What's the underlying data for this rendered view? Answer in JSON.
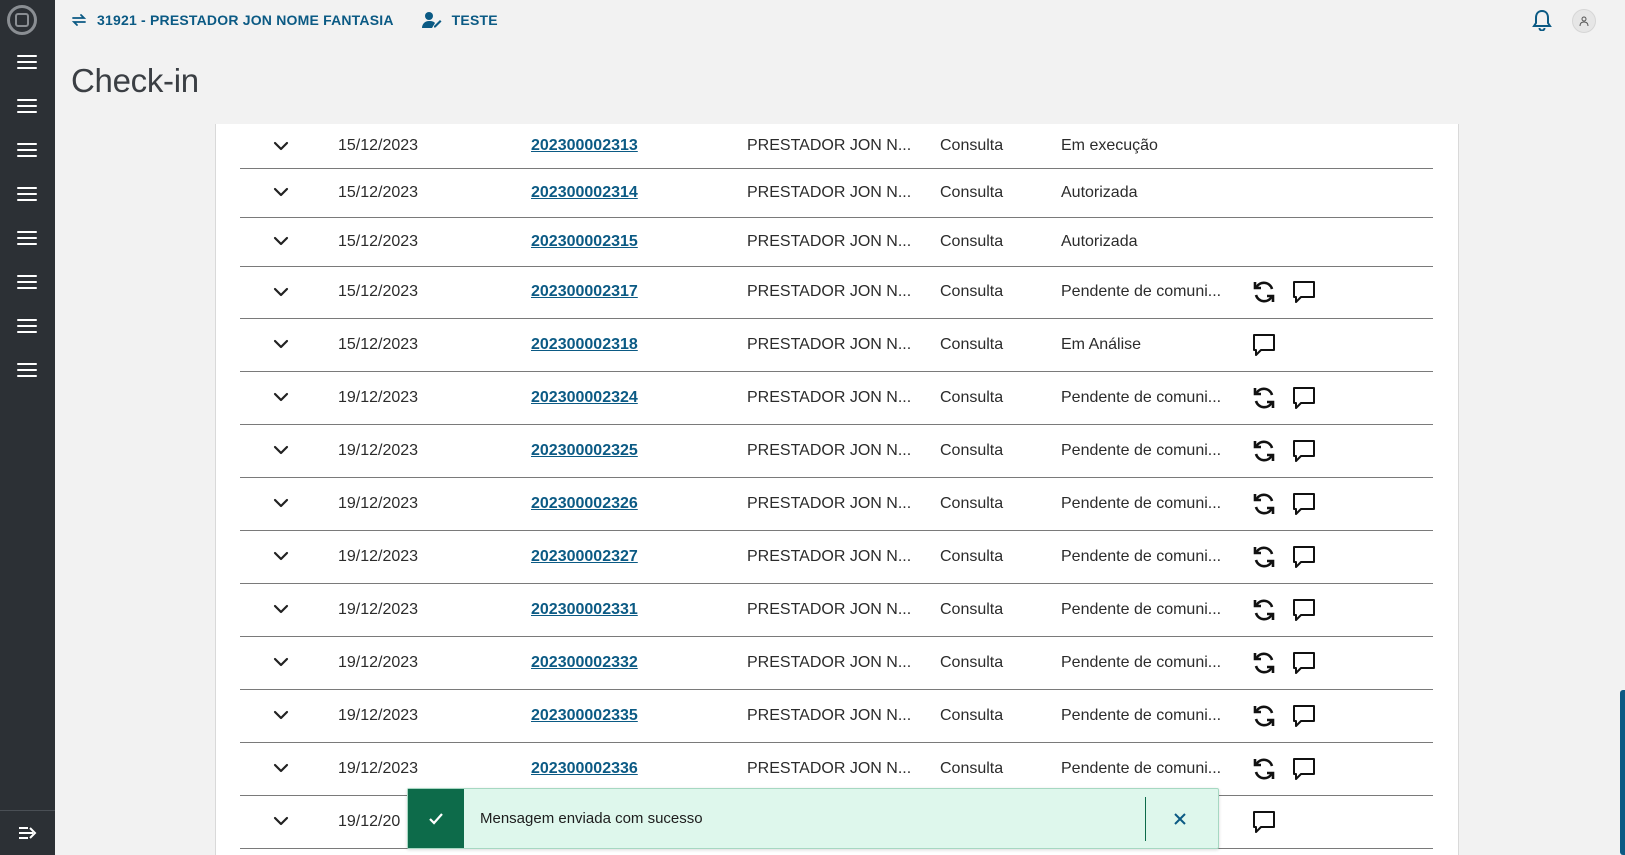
{
  "header": {
    "provider": "31921 - PRESTADOR JON NOME FANTASIA",
    "user": "TESTE"
  },
  "page": {
    "title": "Check-in"
  },
  "table": {
    "rows": [
      {
        "date": "15/12/2023",
        "number": "202300002313",
        "provider": "PRESTADOR JON N...",
        "type": "Consulta",
        "status": "Em execução",
        "actions": []
      },
      {
        "date": "15/12/2023",
        "number": "202300002314",
        "provider": "PRESTADOR JON N...",
        "type": "Consulta",
        "status": "Autorizada",
        "actions": []
      },
      {
        "date": "15/12/2023",
        "number": "202300002315",
        "provider": "PRESTADOR JON N...",
        "type": "Consulta",
        "status": "Autorizada",
        "actions": []
      },
      {
        "date": "15/12/2023",
        "number": "202300002317",
        "provider": "PRESTADOR JON N...",
        "type": "Consulta",
        "status": "Pendente de comuni...",
        "actions": [
          "refresh-icon",
          "chat-icon"
        ]
      },
      {
        "date": "15/12/2023",
        "number": "202300002318",
        "provider": "PRESTADOR JON N...",
        "type": "Consulta",
        "status": "Em Análise",
        "actions": [
          "chat-icon"
        ]
      },
      {
        "date": "19/12/2023",
        "number": "202300002324",
        "provider": "PRESTADOR JON N...",
        "type": "Consulta",
        "status": "Pendente de comuni...",
        "actions": [
          "refresh-icon",
          "chat-icon"
        ]
      },
      {
        "date": "19/12/2023",
        "number": "202300002325",
        "provider": "PRESTADOR JON N...",
        "type": "Consulta",
        "status": "Pendente de comuni...",
        "actions": [
          "refresh-icon",
          "chat-icon"
        ]
      },
      {
        "date": "19/12/2023",
        "number": "202300002326",
        "provider": "PRESTADOR JON N...",
        "type": "Consulta",
        "status": "Pendente de comuni...",
        "actions": [
          "refresh-icon",
          "chat-icon"
        ]
      },
      {
        "date": "19/12/2023",
        "number": "202300002327",
        "provider": "PRESTADOR JON N...",
        "type": "Consulta",
        "status": "Pendente de comuni...",
        "actions": [
          "refresh-icon",
          "chat-icon"
        ]
      },
      {
        "date": "19/12/2023",
        "number": "202300002331",
        "provider": "PRESTADOR JON N...",
        "type": "Consulta",
        "status": "Pendente de comuni...",
        "actions": [
          "refresh-icon",
          "chat-icon"
        ]
      },
      {
        "date": "19/12/2023",
        "number": "202300002332",
        "provider": "PRESTADOR JON N...",
        "type": "Consulta",
        "status": "Pendente de comuni...",
        "actions": [
          "refresh-icon",
          "chat-icon"
        ]
      },
      {
        "date": "19/12/2023",
        "number": "202300002335",
        "provider": "PRESTADOR JON N...",
        "type": "Consulta",
        "status": "Pendente de comuni...",
        "actions": [
          "refresh-icon",
          "chat-icon"
        ]
      },
      {
        "date": "19/12/2023",
        "number": "202300002336",
        "provider": "PRESTADOR JON N...",
        "type": "Consulta",
        "status": "Pendente de comuni...",
        "actions": [
          "refresh-icon",
          "chat-icon"
        ]
      },
      {
        "date": "19/12/20",
        "number": "",
        "provider": "",
        "type": "",
        "status": "",
        "actions": [
          "chat-icon"
        ]
      }
    ]
  },
  "toast": {
    "message": "Mensagem enviada com sucesso"
  },
  "colors": {
    "primary": "#0b5a84",
    "sidebar": "#2c3035",
    "success": "#0d6b4a",
    "success_bg": "#def7ec"
  }
}
